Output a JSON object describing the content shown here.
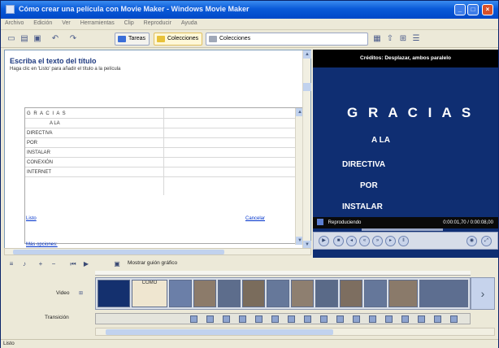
{
  "window": {
    "title": "Cómo crear una película con Movie Maker - Windows Movie Maker",
    "controls": [
      "_",
      "□",
      "×"
    ]
  },
  "menu": [
    "Archivo",
    "Edición",
    "Ver",
    "Herramientas",
    "Clip",
    "Reproducir",
    "Ayuda"
  ],
  "toolbar": {
    "tareas": "Tareas",
    "colecciones_toggle": "Colecciones",
    "colecciones_dropdown": "Colecciones"
  },
  "left": {
    "heading": "Escriba el texto del título",
    "hint": "Haga clic en 'Listo' para añadir el título a la película",
    "lines": [
      "G R A C I A S",
      "A  LA",
      "DIRECTIVA",
      "POR",
      "INSTALAR",
      "CONEXIÓN",
      "INTERNET"
    ],
    "link_done": "Listo",
    "link_cancel": "Cancelar",
    "link_more": "Más opciones:"
  },
  "preview": {
    "title": "Créditos: Desplazar, ambos paralelo",
    "lines": [
      "G R A C I A S",
      "A  LA",
      "DIRECTIVA",
      "POR",
      "INSTALAR"
    ],
    "status_label": "Reproduciendo",
    "time": "0:00:01,70 / 0:00:08,00"
  },
  "timeline": {
    "show_storyboard": "Mostrar guión gráfico",
    "track_video": "Video",
    "track_transition": "Transición",
    "clips": [
      "",
      "COMO",
      "",
      "",
      "",
      "",
      "",
      "",
      "",
      "",
      "",
      "",
      ""
    ]
  },
  "status": "Listo"
}
